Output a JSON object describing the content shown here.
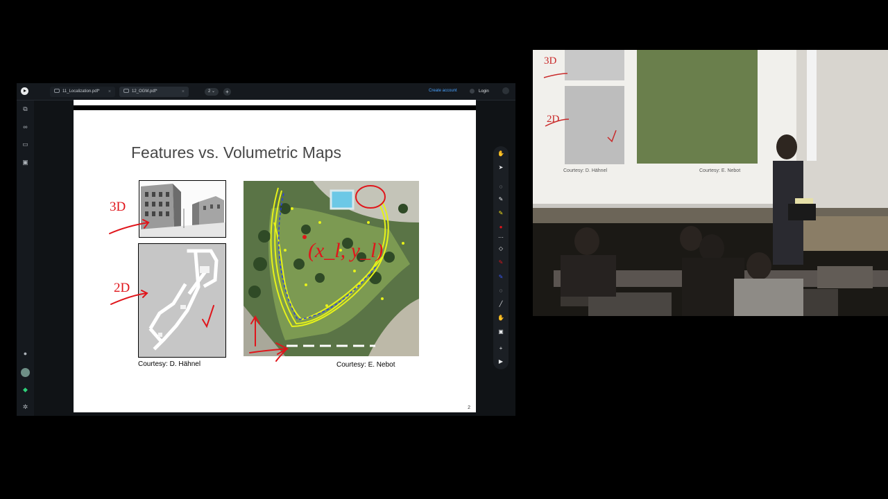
{
  "tabs": [
    {
      "label": "11_Localization.pdf*"
    },
    {
      "label": "12_OGM.pdf*"
    }
  ],
  "toolbar_right": {
    "create_account": "Create account",
    "login": "Login"
  },
  "page_selector": "2",
  "slide": {
    "title": "Features vs. Volumetric Maps",
    "caption_left": "Courtesy: D. Hähnel",
    "caption_right": "Courtesy: E. Nebot",
    "page_number": "2",
    "annotations": {
      "label_3d": "3D",
      "label_2d": "2D",
      "coords": "(x_l, y_l)"
    }
  },
  "projection": {
    "caption_left": "Courtesy: D. Hähnel",
    "caption_right": "Courtesy: E. Nebot",
    "label_3d": "3D",
    "label_2d": "2D"
  },
  "colors": {
    "annotation_red": "#e0151b",
    "link_blue": "#4aa3ff",
    "path_yellow": "#e6f21a"
  },
  "icons": {
    "sidebar": [
      "pages-icon",
      "binoculars-icon",
      "presentation-icon",
      "save-icon",
      "moon-icon",
      "avatar-icon",
      "layers-icon",
      "settings-icon"
    ],
    "tools": [
      "hand-icon",
      "pointer-icon",
      "lasso-icon",
      "pen-icon",
      "highlighter-icon",
      "red-pen-icon",
      "more-icon",
      "eraser-icon",
      "marker-icon",
      "blue-pen-icon",
      "speech-icon",
      "line-icon",
      "grab-icon",
      "image-icon",
      "add-icon",
      "present-icon"
    ]
  }
}
